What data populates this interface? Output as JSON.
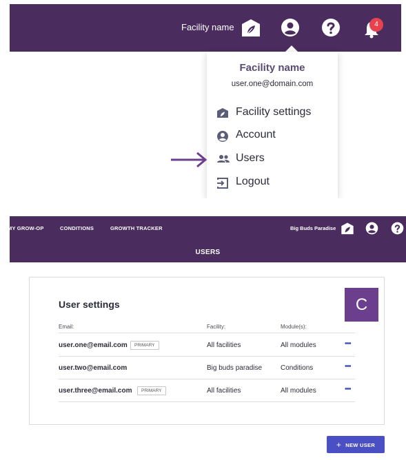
{
  "panel_a": {
    "topbar": {
      "facility_name": "Facility name",
      "notification_count": "4"
    },
    "dropdown": {
      "title": "Facility name",
      "email": "user.one@domain.com",
      "items": [
        {
          "label": "Facility settings",
          "icon": "facility-icon"
        },
        {
          "label": "Account",
          "icon": "account-icon"
        },
        {
          "label": "Users",
          "icon": "users-icon"
        },
        {
          "label": "Logout",
          "icon": "logout-icon"
        }
      ]
    },
    "pointer": "arrow-icon"
  },
  "panel_b": {
    "nav": [
      "MY GROW-OP",
      "CONDITIONS",
      "GROWTH TRACKER"
    ],
    "facility_name": "Big Buds Paradise",
    "page_title": "USERS",
    "card": {
      "title": "User settings",
      "avatar_letter": "C",
      "columns": [
        "Email:",
        "Facility:",
        "Module(s):"
      ],
      "rows": [
        {
          "email": "user.one@email.com",
          "tag": "PRIMARY",
          "facility": "All facilities",
          "modules": "All modules",
          "more": "•••"
        },
        {
          "email": "user.two@email.com",
          "tag": "",
          "facility": "Big buds paradise",
          "modules": "Conditions",
          "more": "•••"
        },
        {
          "email": "user.three@email.com",
          "tag": "PRIMARY",
          "facility": "All facilities",
          "modules": "All modules",
          "more": "•••"
        }
      ]
    },
    "new_user_label": "NEW USER",
    "new_user_icon": "+"
  },
  "colors": {
    "topbar": "#4a2d5e",
    "accent": "#6b3f8e",
    "button": "#4a4fc4",
    "badge": "#e8424f"
  }
}
